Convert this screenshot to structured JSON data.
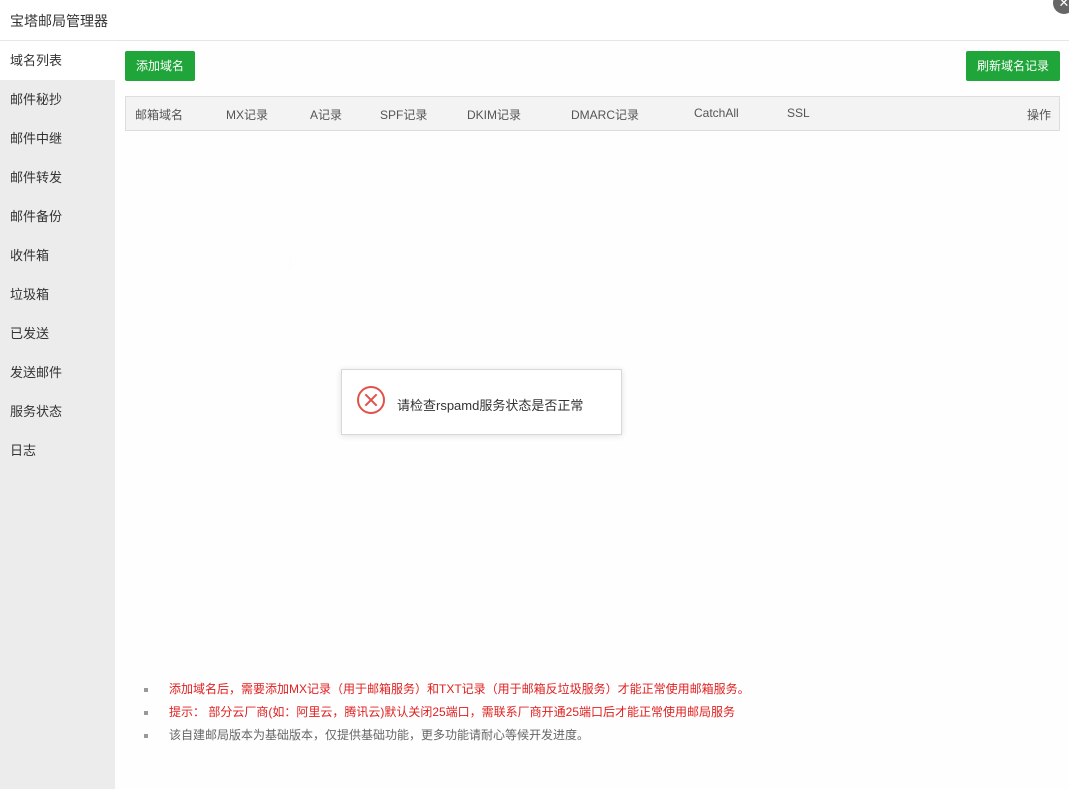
{
  "window": {
    "title": "宝塔邮局管理器",
    "close_glyph": "✕"
  },
  "sidebar": {
    "items": [
      {
        "label": "域名列表",
        "active": true
      },
      {
        "label": "邮件秘抄"
      },
      {
        "label": "邮件中继"
      },
      {
        "label": "邮件转发"
      },
      {
        "label": "邮件备份"
      },
      {
        "label": "收件箱"
      },
      {
        "label": "垃圾箱"
      },
      {
        "label": "已发送"
      },
      {
        "label": "发送邮件"
      },
      {
        "label": "服务状态"
      },
      {
        "label": "日志"
      }
    ]
  },
  "toolbar": {
    "add_label": "添加域名",
    "refresh_label": "刷新域名记录"
  },
  "table": {
    "columns": [
      "邮箱域名",
      "MX记录",
      "A记录",
      "SPF记录",
      "DKIM记录",
      "DMARC记录",
      "CatchAll",
      "SSL",
      "操作"
    ]
  },
  "notes": [
    {
      "text": "添加域名后，需要添加MX记录（用于邮箱服务）和TXT记录（用于邮箱反垃圾服务）才能正常使用邮箱服务。",
      "tone": "red"
    },
    {
      "text": "提示： 部分云厂商(如：阿里云，腾讯云)默认关闭25端口，需联系厂商开通25端口后才能正常使用邮局服务",
      "tone": "red"
    },
    {
      "text": "该自建邮局版本为基础版本，仅提供基础功能，更多功能请耐心等候开发进度。",
      "tone": "gray"
    }
  ],
  "toast": {
    "message": "请检查rspamd服务状态是否正常",
    "icon": "error-icon"
  },
  "colors": {
    "accent": "#20a53a",
    "error": "#e0524c",
    "warning_text": "#e02020"
  }
}
